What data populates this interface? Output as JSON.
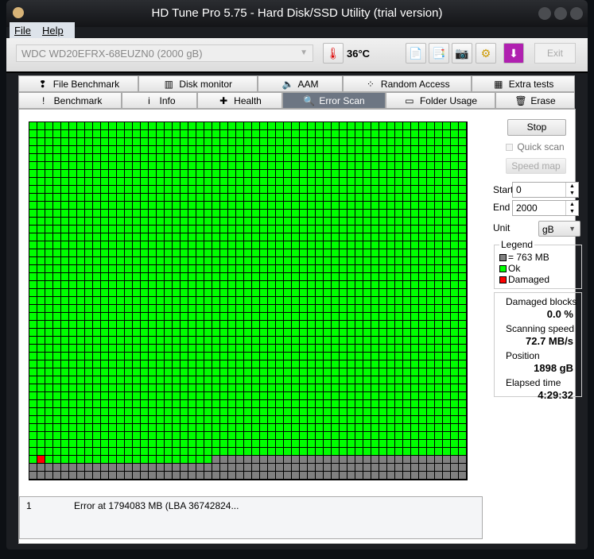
{
  "window": {
    "title": "HD Tune Pro 5.75 - Hard Disk/SSD Utility (trial version)"
  },
  "menu": [
    "File",
    "Help"
  ],
  "toolbar": {
    "drive": "WDC WD20EFRX-68EUZN0 (2000 gB)",
    "temperature": "36°C",
    "exit_label": "Exit",
    "buttons": [
      "copy-text-icon",
      "copy-screenshot-icon",
      "camera-icon",
      "options-icon",
      "save-down-icon"
    ]
  },
  "tabs_top": [
    {
      "label": "File Benchmark",
      "icon": "file-benchmark-icon",
      "glyph": "❢"
    },
    {
      "label": "Disk monitor",
      "icon": "disk-monitor-icon",
      "glyph": "▥"
    },
    {
      "label": "AAM",
      "icon": "speaker-icon",
      "glyph": "🔈"
    },
    {
      "label": "Random Access",
      "icon": "random-access-icon",
      "glyph": "⁘"
    },
    {
      "label": "Extra tests",
      "icon": "extra-tests-icon",
      "glyph": "▦"
    }
  ],
  "tabs_bottom": [
    {
      "label": "Benchmark",
      "icon": "exclamation-icon",
      "glyph": "!"
    },
    {
      "label": "Info",
      "icon": "info-icon",
      "glyph": "i"
    },
    {
      "label": "Health",
      "icon": "health-cross-icon",
      "glyph": "✚"
    },
    {
      "label": "Error Scan",
      "icon": "magnifier-icon",
      "glyph": "🔍",
      "active": true
    },
    {
      "label": "Folder Usage",
      "icon": "folder-icon",
      "glyph": "▭"
    },
    {
      "label": "Erase",
      "icon": "trash-icon",
      "glyph": "🗑"
    }
  ],
  "scan": {
    "columns": 55,
    "rows": 45,
    "scanned_blocks": 2333,
    "damaged_blocks": [
      2311
    ],
    "colors": {
      "ok": "#00ff00",
      "damaged": "#ff0000",
      "unscanned": "#808080"
    }
  },
  "controls": {
    "stop": "Stop",
    "quick_scan": "Quick scan",
    "quick_scan_checked": false,
    "speed_map": "Speed map",
    "start_label": "Start",
    "start": "0",
    "end_label": "End",
    "end": "2000",
    "unit_label": "Unit",
    "unit": "gB"
  },
  "legend": {
    "title": "Legend",
    "block": "= 763 MB",
    "ok": "Ok",
    "damaged": "Damaged"
  },
  "stats": {
    "damaged_label": "Damaged blocks",
    "damaged": "0.0 %",
    "speed_label": "Scanning speed",
    "speed": "72.7 MB/s",
    "position_label": "Position",
    "position": "1898 gB",
    "elapsed_label": "Elapsed time",
    "elapsed": "4:29:32"
  },
  "log": [
    {
      "n": "1",
      "text": "Error at 1794083 MB (LBA 36742824..."
    }
  ]
}
